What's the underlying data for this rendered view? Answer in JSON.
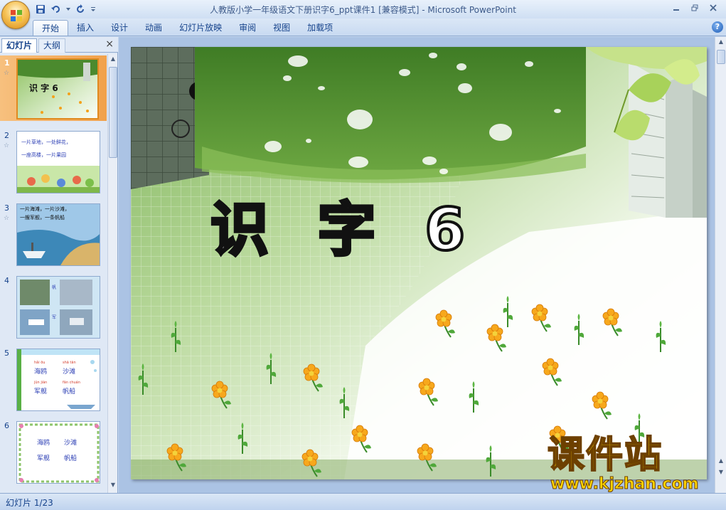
{
  "window": {
    "title_doc": "人教版小学一年级语文下册识字6_ppt课件1 [兼容模式]",
    "title_app": " - Microsoft PowerPoint"
  },
  "quick_access": {
    "save": "save-icon",
    "undo": "undo-icon",
    "redo": "repeat-icon",
    "more": "dropdown-icon"
  },
  "ribbon": {
    "tabs": [
      "开始",
      "插入",
      "设计",
      "动画",
      "幻灯片放映",
      "审阅",
      "视图",
      "加载项"
    ],
    "active": "开始",
    "help": "?"
  },
  "panel": {
    "tab_slides": "幻灯片",
    "tab_outline": "大纲",
    "close": "×"
  },
  "slides": [
    {
      "num": "1",
      "title": "识 字 6"
    },
    {
      "num": "2",
      "lines": [
        "一片草地，一处鲜花，",
        "一座高楼，一片果园"
      ]
    },
    {
      "num": "3",
      "lines": [
        "一片海滩，一片沙滩，",
        "一艘军舰，一条帆船"
      ]
    },
    {
      "num": "4",
      "labels": [
        "帆",
        "军"
      ]
    },
    {
      "num": "5",
      "words": [
        [
          "hǎi ōu",
          "海鸥"
        ],
        [
          "shā tān",
          "沙滩"
        ],
        [
          "jūn jiàn",
          "军舰"
        ],
        [
          "fān chuán",
          "帆船"
        ]
      ]
    },
    {
      "num": "6",
      "words": [
        "海鸥",
        "沙滩",
        "军舰",
        "帆船"
      ]
    }
  ],
  "main_slide": {
    "title": "识 字 6"
  },
  "status": {
    "slide_counter": "幻灯片 1/23"
  },
  "watermark": {
    "cn": "课件站",
    "url": "www.kjzhan.com"
  },
  "colors": {
    "accent": "#15428b",
    "slide_green": "#6fa83a",
    "flower": "#f4a11a"
  }
}
